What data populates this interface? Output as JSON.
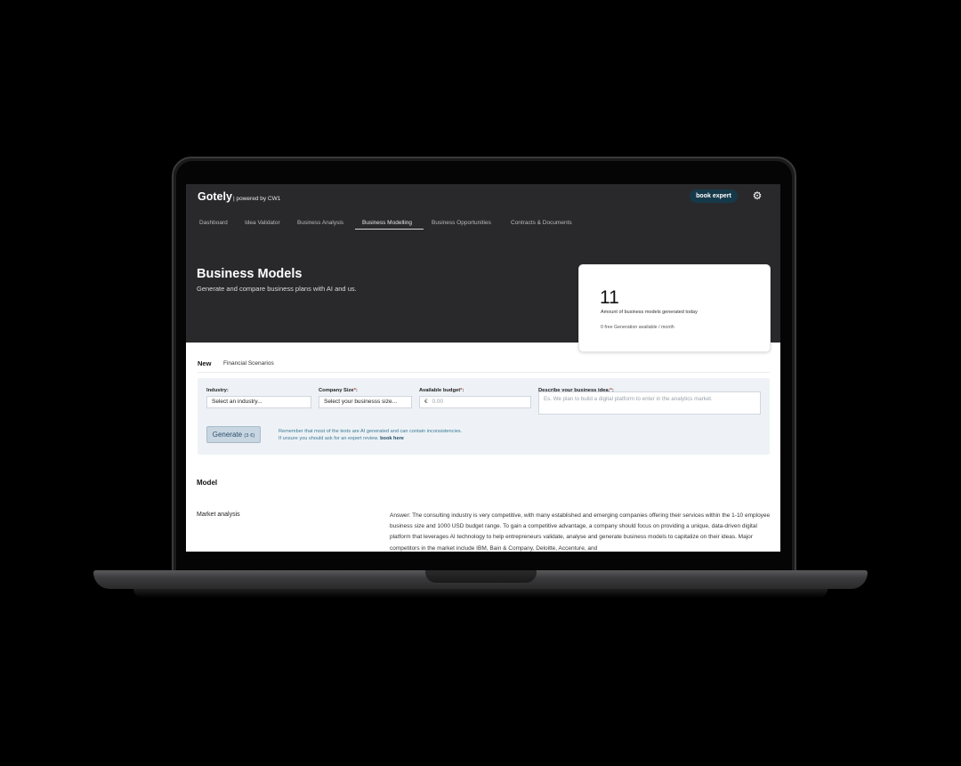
{
  "app": {
    "brand": "Gotely",
    "powered_by": "| powered by CW1",
    "book_expert": "book expert"
  },
  "nav": {
    "items": [
      {
        "label": "Dashboard"
      },
      {
        "label": "Idea Validator"
      },
      {
        "label": "Business Analysis"
      },
      {
        "label": "Business Modelling",
        "active": true
      },
      {
        "label": "Business Opportunities"
      },
      {
        "label": "Contracts & Documents"
      }
    ]
  },
  "hero": {
    "title": "Business Models",
    "subtitle": "Generate and compare business plans with AI and us."
  },
  "stat": {
    "value": "11",
    "label": "Amount of business models generated today",
    "note": "0 free Generation available / month"
  },
  "tabs": {
    "new": "New",
    "financial": "Financial Scenarios"
  },
  "form": {
    "industry_label": "Industry:",
    "industry_value": "Select an industry...",
    "company_size_label": "Company Size",
    "company_size_value": "Select your businesss size...",
    "budget_label": "Available budget",
    "budget_currency": "€",
    "budget_placeholder": "0.00",
    "idea_label": "Describe your business idea:",
    "idea_placeholder": "Es. We plan to build a digital platform to enter in the analytics market.",
    "required_mark": "*",
    "required_colon": ":",
    "generate_label": "Generate",
    "generate_cost": "(3 €)",
    "notice_line1": "Remember that most of the texts are AI generated and can contain inconsistencies.",
    "notice_line2": "If unsure you should ask for an expert review.",
    "notice_link": "book here"
  },
  "model": {
    "title": "Model",
    "market_analysis_label": "Market analysis",
    "market_analysis_text": "Answer: The consulting industry is very competitive, with many established and emerging companies offering their services within the 1-10 employee business size and 1000 USD budget range. To gain a competitive advantage, a company should focus on providing a unique, data-driven digital platform that leverages AI technology to help entrepreneurs validate, analyse and generate business models to capitalize on their ideas. Major competitors in the market include IBM, Bain & Company, Deloitte, Accenture, and"
  },
  "icons": {
    "settings": "gear-icon"
  },
  "colors": {
    "hero_bg": "#29292b",
    "accent_button": "#16394a",
    "form_bg": "#eef2f6",
    "notice_text": "#3b7b96"
  }
}
